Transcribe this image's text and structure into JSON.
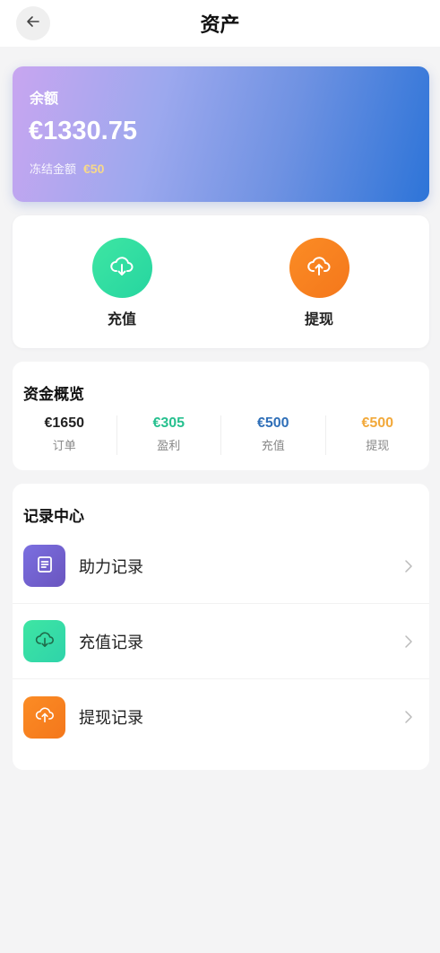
{
  "header": {
    "title": "资产",
    "back_icon": "arrow-left-icon"
  },
  "balance": {
    "label": "余额",
    "amount": "€1330.75",
    "frozen_label": "冻结金额",
    "frozen_value": "€50",
    "gradient_colors": [
      "#c8a6f0",
      "#9ca8ee",
      "#6f92e2",
      "#2d74d8"
    ],
    "frozen_color": "#f7d98a"
  },
  "actions": [
    {
      "label": "充值",
      "icon": "cloud-download-icon",
      "color": "#2fdba2"
    },
    {
      "label": "提现",
      "icon": "cloud-upload-icon",
      "color": "#f6801e"
    }
  ],
  "overview": {
    "title": "资金概览",
    "stats": [
      {
        "value": "€1650",
        "label": "订单",
        "color": "#222222"
      },
      {
        "value": "€305",
        "label": "盈利",
        "color": "#27c08f"
      },
      {
        "value": "€500",
        "label": "充值",
        "color": "#2f6fb8"
      },
      {
        "value": "€500",
        "label": "提现",
        "color": "#f2a93b"
      }
    ]
  },
  "records": {
    "title": "记录中心",
    "items": [
      {
        "label": "助力记录",
        "icon": "document-list-icon",
        "color": "#6f5fd4"
      },
      {
        "label": "充值记录",
        "icon": "cloud-download-icon",
        "color": "#33dba7"
      },
      {
        "label": "提现记录",
        "icon": "cloud-upload-icon",
        "color": "#f6801e"
      }
    ]
  }
}
